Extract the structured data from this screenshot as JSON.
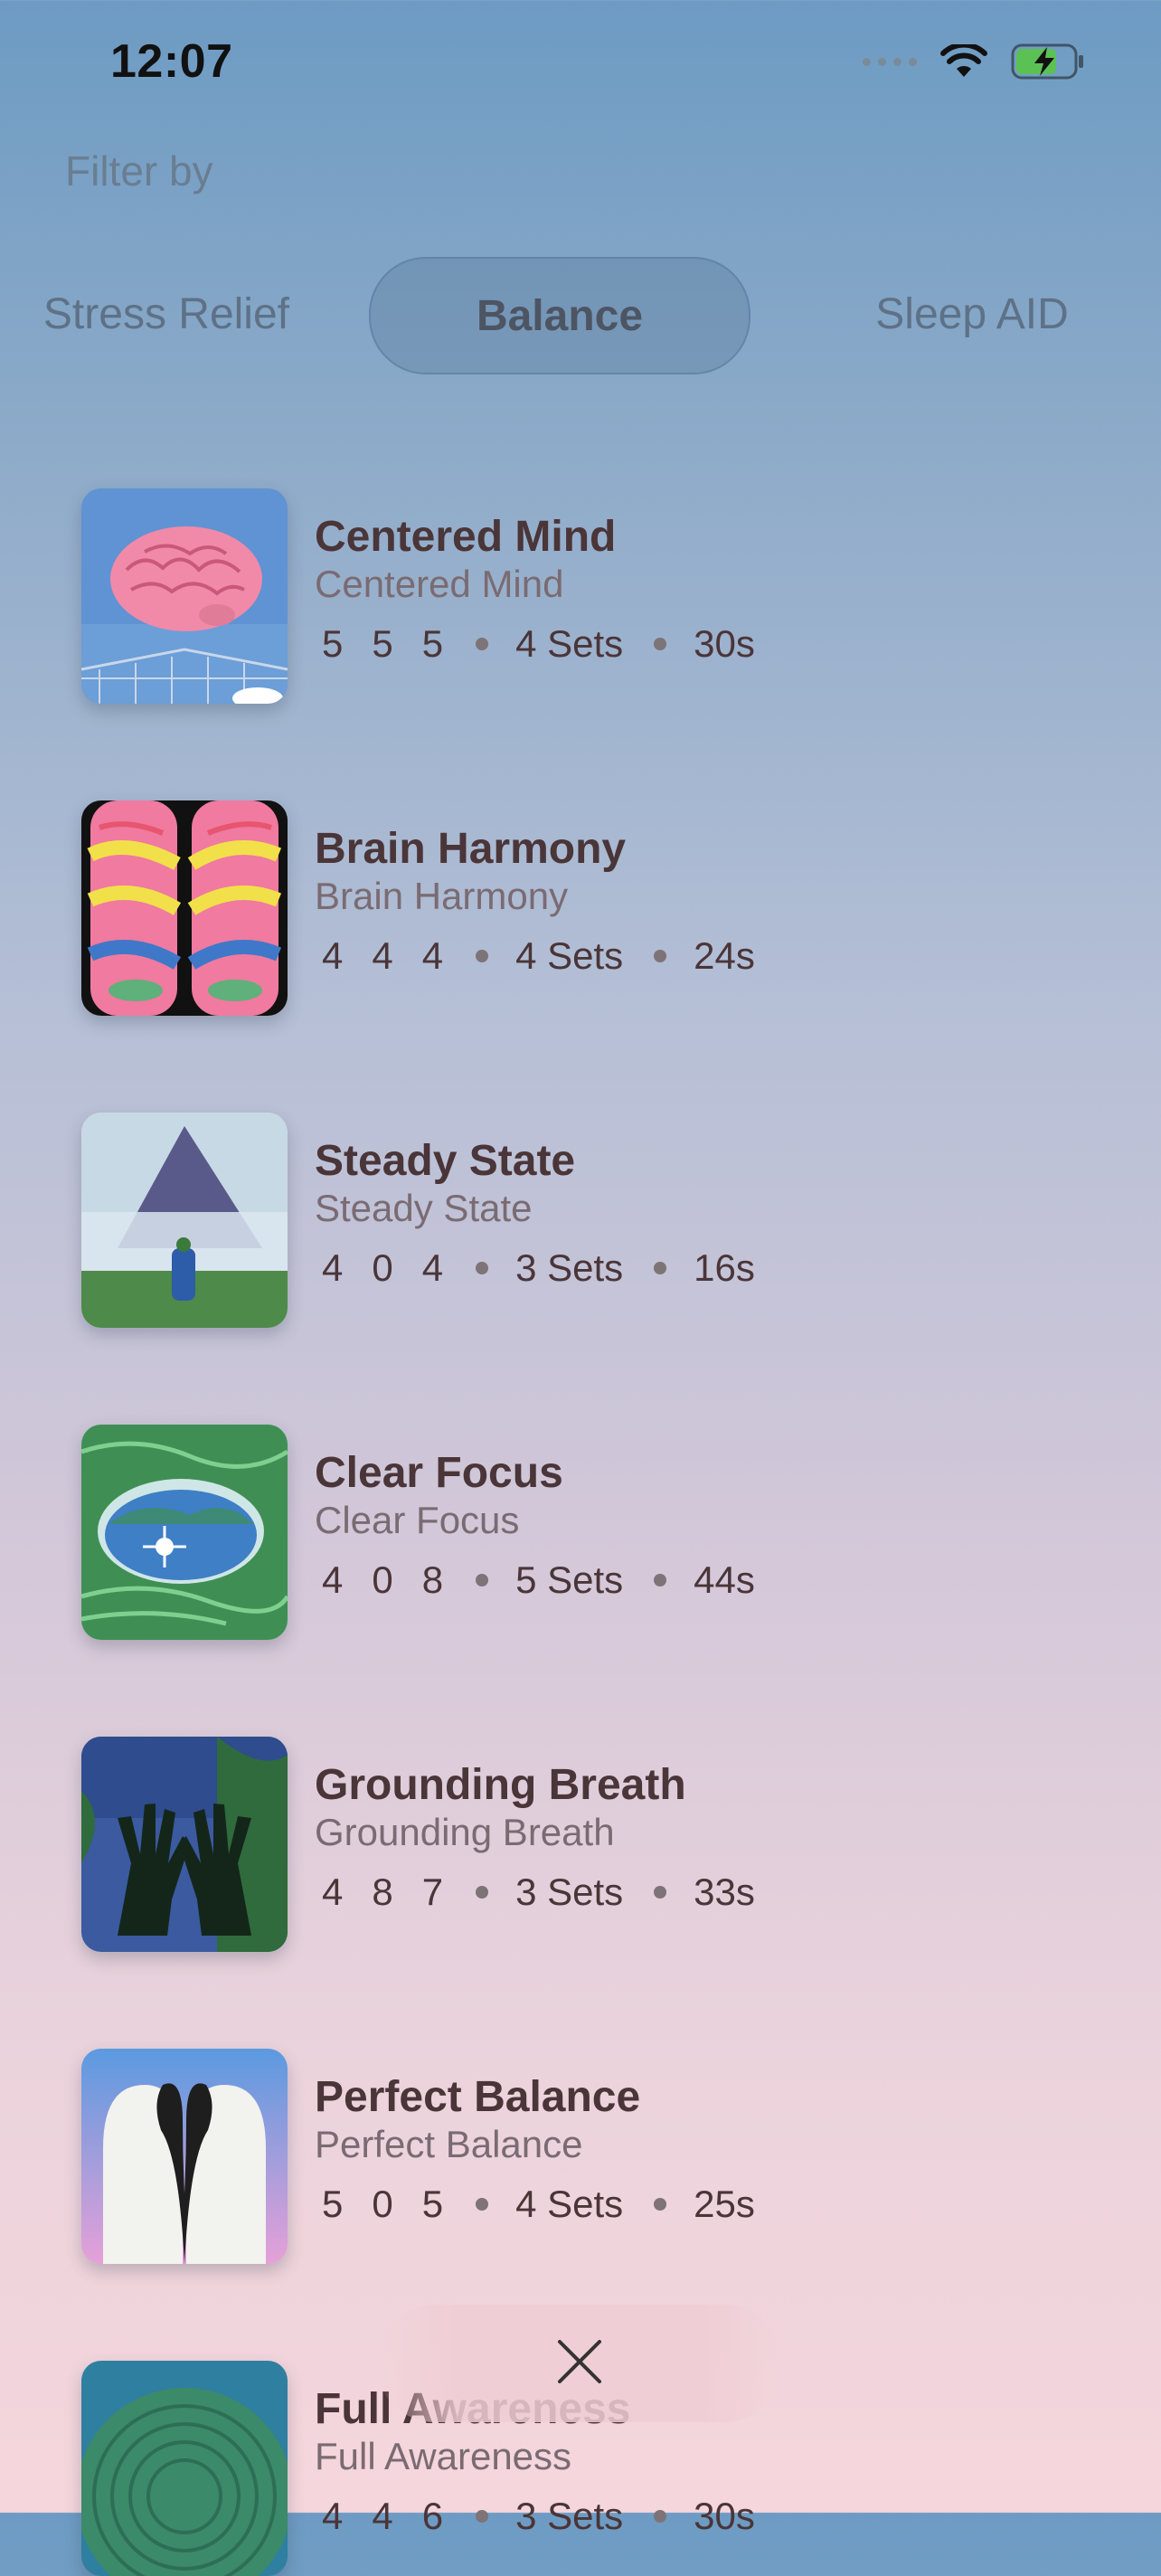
{
  "status": {
    "time": "12:07"
  },
  "filter": {
    "label": "Filter by",
    "tabs": [
      "Stress Relief",
      "Balance",
      "Sleep AID"
    ],
    "selected": "Balance"
  },
  "sessions": [
    {
      "title": "Centered Mind",
      "subtitle": "Centered Mind",
      "pattern": [
        "5",
        "5",
        "5"
      ],
      "sets": "4 Sets",
      "duration": "30s"
    },
    {
      "title": "Brain Harmony",
      "subtitle": "Brain Harmony",
      "pattern": [
        "4",
        "4",
        "4"
      ],
      "sets": "4 Sets",
      "duration": "24s"
    },
    {
      "title": "Steady State",
      "subtitle": "Steady State",
      "pattern": [
        "4",
        "0",
        "4"
      ],
      "sets": "3 Sets",
      "duration": "16s"
    },
    {
      "title": "Clear Focus",
      "subtitle": "Clear Focus",
      "pattern": [
        "4",
        "0",
        "8"
      ],
      "sets": "5 Sets",
      "duration": "44s"
    },
    {
      "title": "Grounding Breath",
      "subtitle": "Grounding Breath",
      "pattern": [
        "4",
        "8",
        "7"
      ],
      "sets": "3 Sets",
      "duration": "33s"
    },
    {
      "title": "Perfect Balance",
      "subtitle": "Perfect Balance",
      "pattern": [
        "5",
        "0",
        "5"
      ],
      "sets": "4 Sets",
      "duration": "25s"
    },
    {
      "title": "Full Awareness",
      "subtitle": "Full Awareness",
      "pattern": [
        "4",
        "4",
        "6"
      ],
      "sets": "3 Sets",
      "duration": "30s"
    }
  ],
  "icons": {
    "status": [
      "cellular-icon",
      "wifi-icon",
      "battery-charging-icon"
    ],
    "close": "close-icon"
  }
}
